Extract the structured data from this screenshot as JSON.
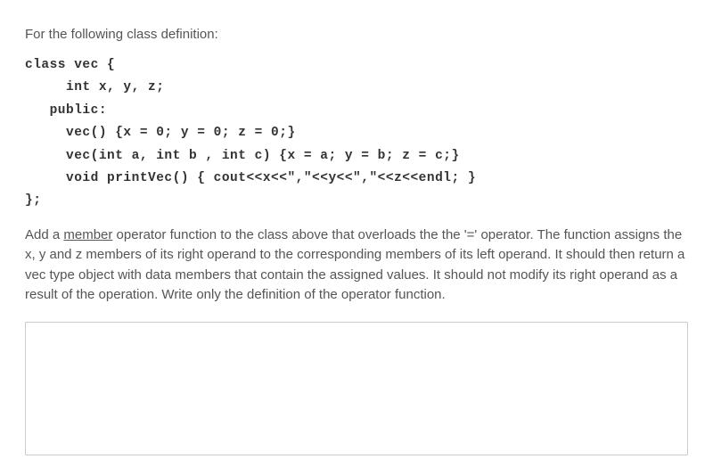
{
  "intro": "For the following class definition:",
  "code": {
    "line1": "class vec {",
    "line2": "     int x, y, z;",
    "line3": "   public:",
    "line4": "     vec() {x = 0; y = 0; z = 0;}",
    "line5": "     vec(int a, int b , int c) {x = a; y = b; z = c;}",
    "line6": "     void printVec() { cout<<x<<\",\"<<y<<\",\"<<z<<endl; }",
    "line7": "};"
  },
  "instructions": {
    "prefix": "Add a ",
    "emphasized": "member",
    "suffix": " operator function to the class above that overloads the the '=' operator. The function assigns the x, y and z members of its right operand to the corresponding members of its left operand. It should then return a vec type object with data members that contain the assigned values. It should not modify its right operand as a result of the operation. Write only the definition of the operator function."
  },
  "answer": {
    "value": "",
    "placeholder": ""
  }
}
